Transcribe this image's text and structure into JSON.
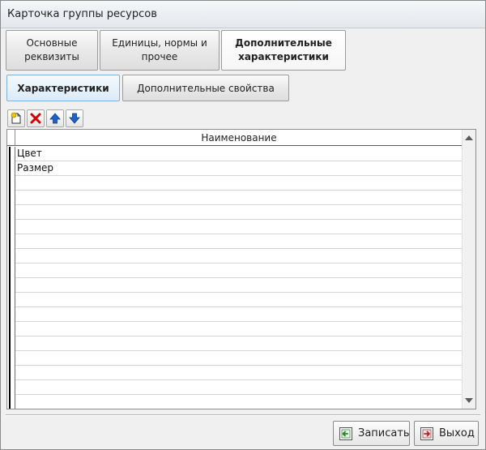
{
  "window": {
    "title": "Карточка группы ресурсов"
  },
  "tabs": [
    {
      "label": "Основные\nреквизиты",
      "active": false
    },
    {
      "label": "Единицы, нормы и\nпрочее",
      "active": false
    },
    {
      "label": "Дополнительные\nхарактеристики",
      "active": true
    }
  ],
  "subtabs": [
    {
      "label": "Характеристики",
      "active": true
    },
    {
      "label": "Дополнительные свойства",
      "active": false
    }
  ],
  "toolbar": {
    "icons": [
      "add-row-icon",
      "delete-icon",
      "move-up-icon",
      "move-down-icon"
    ]
  },
  "grid": {
    "column_header": "Наименование",
    "rows": [
      "Цвет",
      "Размер",
      "",
      "",
      "",
      "",
      "",
      "",
      "",
      "",
      "",
      "",
      "",
      "",
      "",
      "",
      "",
      ""
    ]
  },
  "footer": {
    "save_label": "Записать",
    "exit_label": "Выход"
  },
  "colors": {
    "delete": "#d40000",
    "arrow": "#1e63c9",
    "active_subtab_border": "#7fb1d6"
  }
}
